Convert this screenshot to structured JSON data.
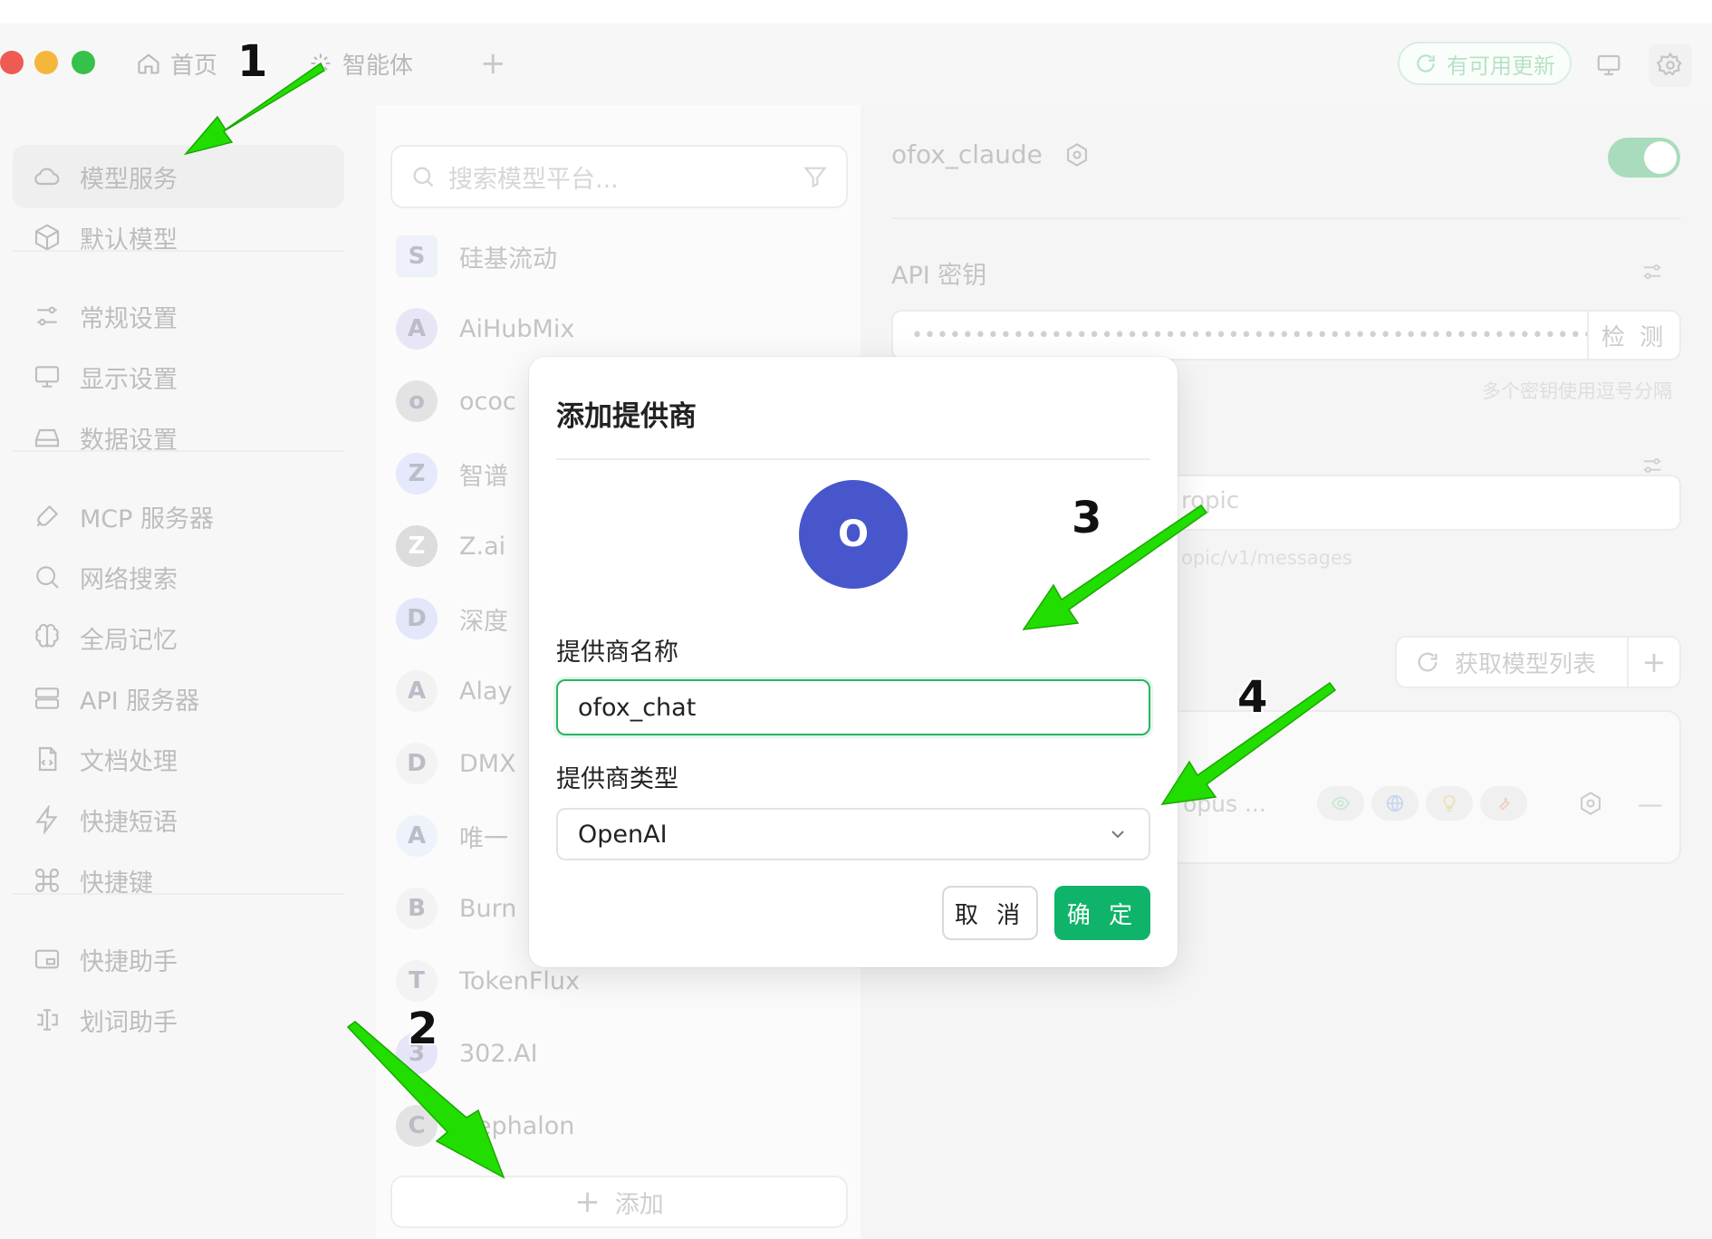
{
  "titlebar": {
    "tabs": [
      {
        "label": "首页",
        "icon": "home-icon"
      },
      {
        "label": "智能体",
        "icon": "sparkle-icon"
      }
    ],
    "add_tab": "+",
    "update_label": "有可用更新"
  },
  "sidebar": {
    "items": [
      {
        "label": "模型服务",
        "icon": "cloud-icon",
        "active": true
      },
      {
        "label": "默认模型",
        "icon": "cube-icon"
      },
      {
        "label": "常规设置",
        "icon": "sliders-icon"
      },
      {
        "label": "显示设置",
        "icon": "monitor-icon"
      },
      {
        "label": "数据设置",
        "icon": "drive-icon"
      },
      {
        "label": "MCP 服务器",
        "icon": "plug-icon"
      },
      {
        "label": "网络搜索",
        "icon": "search-icon"
      },
      {
        "label": "全局记忆",
        "icon": "brain-icon"
      },
      {
        "label": "API 服务器",
        "icon": "server-icon"
      },
      {
        "label": "文档处理",
        "icon": "document-icon"
      },
      {
        "label": "快捷短语",
        "icon": "bolt-icon"
      },
      {
        "label": "快捷键",
        "icon": "command-icon"
      },
      {
        "label": "快捷助手",
        "icon": "window-icon"
      },
      {
        "label": "划词助手",
        "icon": "text-cursor-icon"
      }
    ]
  },
  "provider_list": {
    "search_placeholder": "搜索模型平台...",
    "providers": [
      {
        "name": "硅基流动",
        "logo": "S"
      },
      {
        "name": "AiHubMix",
        "logo": "A"
      },
      {
        "name": "ococ",
        "logo": "o"
      },
      {
        "name": "智谱",
        "logo": "Z"
      },
      {
        "name": "Z.ai",
        "logo": "Z"
      },
      {
        "name": "深度",
        "logo": "D"
      },
      {
        "name": "Alay",
        "logo": "A"
      },
      {
        "name": "DMX",
        "logo": "D"
      },
      {
        "name": "唯一",
        "logo": "A"
      },
      {
        "name": "Burn",
        "logo": "B"
      },
      {
        "name": "TokenFlux",
        "logo": "T"
      },
      {
        "name": "302.AI",
        "logo": "3"
      },
      {
        "name": "Cephalon",
        "logo": "C"
      }
    ],
    "add_label": "添加"
  },
  "detail": {
    "provider_name": "ofox_claude",
    "api_key_title": "API 密钥",
    "api_key_mask": "••••••••••••••••••••••••••••••••••••••••••••••••••••••••••••••••",
    "check_label": "检 测",
    "api_key_hint": "多个密钥使用逗号分隔",
    "host_value": "ropic",
    "host_hint": "opic/v1/messages",
    "fetch_models_label": "获取模型列表",
    "model_name": "opus ..."
  },
  "modal": {
    "title": "添加提供商",
    "avatar_letter": "O",
    "name_label": "提供商名称",
    "name_value": "ofox_chat",
    "type_label": "提供商类型",
    "type_value": "OpenAI",
    "cancel_label": "取 消",
    "ok_label": "确 定"
  },
  "annotations": {
    "steps": [
      "1",
      "2",
      "3",
      "4"
    ],
    "arrow_color": "#22dd00"
  }
}
